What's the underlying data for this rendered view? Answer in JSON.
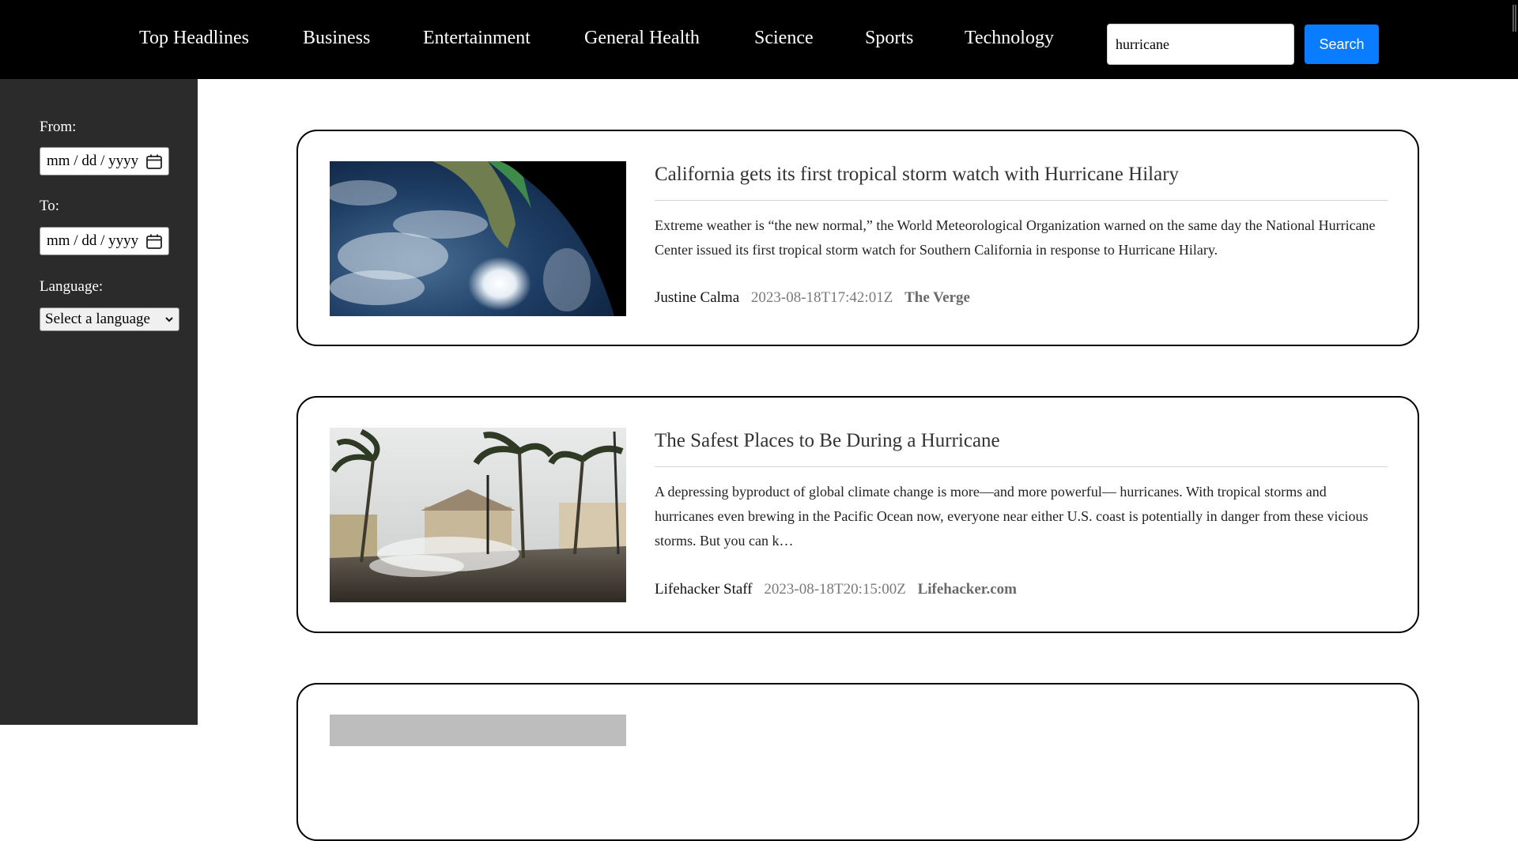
{
  "nav": {
    "links": [
      "Top Headlines",
      "Business",
      "Entertainment",
      "General Health",
      "Science",
      "Sports",
      "Technology"
    ],
    "search_value": "hurricane",
    "search_button": "Search"
  },
  "sidebar": {
    "from_label": "From:",
    "from_placeholder": "mm / dd / yyyy",
    "to_label": "To:",
    "to_placeholder": "mm / dd / yyyy",
    "language_label": "Language:",
    "language_selected": "Select a language"
  },
  "articles": [
    {
      "title": "California gets its first tropical storm watch with Hurricane Hilary",
      "description": "Extreme weather is “the new normal,” the World Meteorological Organization warned on the same day the National Hurricane Center issued its first tropical storm watch for Southern California in response to Hurricane Hilary.",
      "author": "Justine Calma",
      "published": "2023-08-18T17:42:01Z",
      "source": "The Verge"
    },
    {
      "title": "The Safest Places to Be During a Hurricane",
      "description": "A depressing byproduct of global climate change is more—and more powerful— hurricanes. With tropical storms and hurricanes even brewing in the Pacific Ocean now, everyone near either U.S. coast is potentially in danger from these vicious storms. But you can k…",
      "author": "Lifehacker Staff",
      "published": "2023-08-18T20:15:00Z",
      "source": "Lifehacker.com"
    }
  ],
  "colors": {
    "topbar": "#000000",
    "sidebar": "#2b2b2b",
    "search_button": "#0a7cff"
  }
}
